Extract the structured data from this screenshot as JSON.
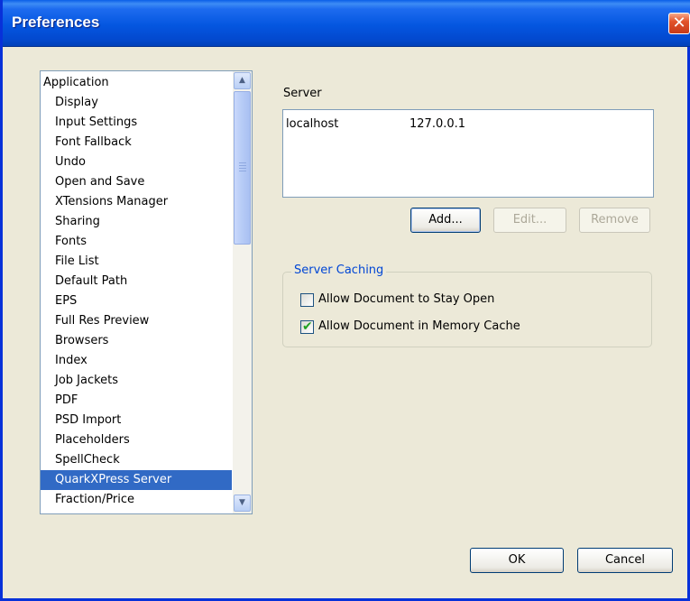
{
  "window": {
    "title": "Preferences",
    "close_glyph": "✕"
  },
  "categories": {
    "items": [
      {
        "label": "Application"
      },
      {
        "label": "Display"
      },
      {
        "label": "Input Settings"
      },
      {
        "label": "Font Fallback"
      },
      {
        "label": "Undo"
      },
      {
        "label": "Open and Save"
      },
      {
        "label": "XTensions Manager"
      },
      {
        "label": "Sharing"
      },
      {
        "label": "Fonts"
      },
      {
        "label": "File List"
      },
      {
        "label": "Default Path"
      },
      {
        "label": "EPS"
      },
      {
        "label": "Full Res Preview"
      },
      {
        "label": "Browsers"
      },
      {
        "label": "Index"
      },
      {
        "label": "Job Jackets"
      },
      {
        "label": "PDF"
      },
      {
        "label": "PSD Import"
      },
      {
        "label": "Placeholders"
      },
      {
        "label": "SpellCheck"
      },
      {
        "label": "QuarkXPress Server"
      },
      {
        "label": "Fraction/Price"
      }
    ],
    "selected": "QuarkXPress Server",
    "scroll_up_glyph": "▲",
    "scroll_down_glyph": "▼"
  },
  "server": {
    "label": "Server",
    "entries": [
      {
        "name": "localhost",
        "address": "127.0.0.1"
      }
    ],
    "add_label": "Add...",
    "edit_label": "Edit...",
    "remove_label": "Remove"
  },
  "caching": {
    "legend": "Server Caching",
    "options": [
      {
        "label": "Allow Document to Stay Open",
        "checked": false
      },
      {
        "label": "Allow Document in Memory Cache",
        "checked": true
      }
    ],
    "check_glyph": "✔"
  },
  "footer": {
    "ok_label": "OK",
    "cancel_label": "Cancel"
  },
  "colors": {
    "selection": "#316ac5",
    "titlebar": "#0456e0",
    "legend": "#0046d5",
    "dialog": "#ece9d8"
  }
}
